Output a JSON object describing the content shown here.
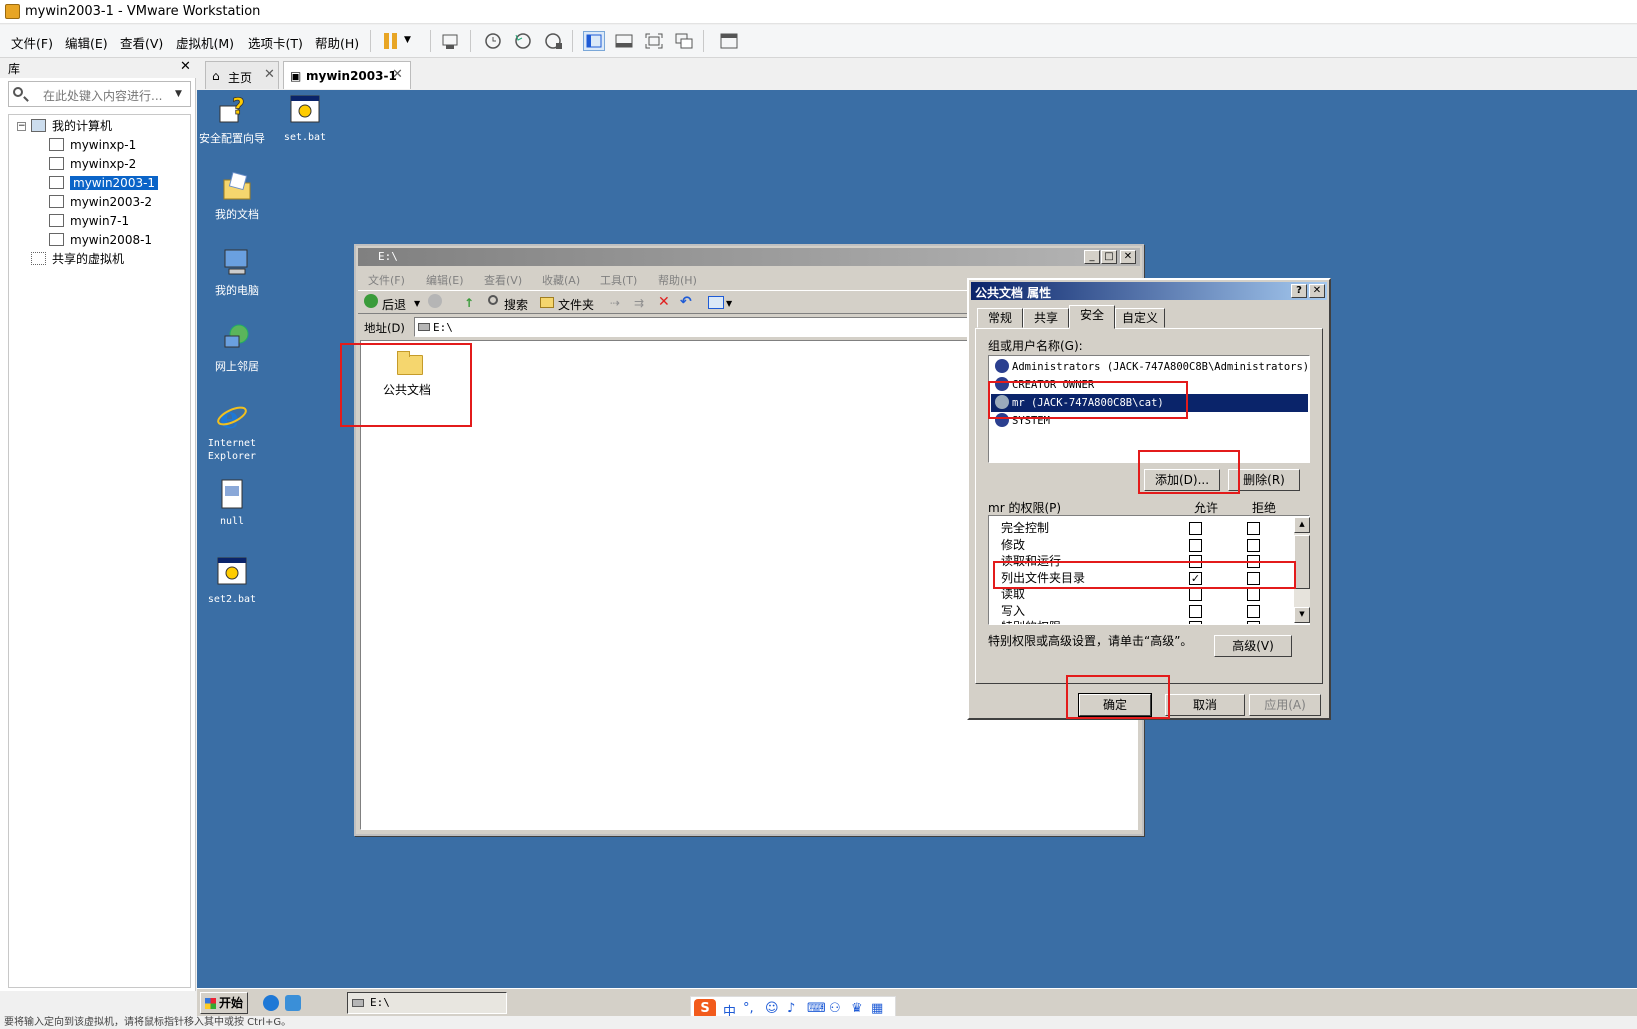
{
  "window": {
    "title": "mywin2003-1 - VMware Workstation"
  },
  "menubar": [
    "文件(F)",
    "编辑(E)",
    "查看(V)",
    "虚拟机(M)",
    "选项卡(T)",
    "帮助(H)"
  ],
  "library": {
    "title": "库",
    "search_placeholder": "在此处键入内容进行...",
    "root": "我的计算机",
    "vms": [
      "mywinxp-1",
      "mywinxp-2",
      "mywin2003-1",
      "mywin2003-2",
      "mywin7-1",
      "mywin2008-1"
    ],
    "selected_vm": "mywin2003-1",
    "shared": "共享的虚拟机"
  },
  "tabs": {
    "home": "主页",
    "vm": "mywin2003-1"
  },
  "desktop_icons": [
    "安全配置向导",
    "set.bat",
    "我的文档",
    "我的电脑",
    "网上邻居",
    "Internet Explorer",
    "null",
    "set2.bat"
  ],
  "explorer": {
    "title": "E:\\",
    "menu": [
      "文件(F)",
      "编辑(E)",
      "查看(V)",
      "收藏(A)",
      "工具(T)",
      "帮助(H)"
    ],
    "toolbar": {
      "back": "后退",
      "search": "搜索",
      "folders": "文件夹"
    },
    "address_label": "地址(D)",
    "address_value": "E:\\",
    "folder_name": "公共文档"
  },
  "properties": {
    "title": "公共文档 属性",
    "tabs": [
      "常规",
      "共享",
      "安全",
      "自定义"
    ],
    "active_tab": "安全",
    "users_label": "组或用户名称(G):",
    "users": [
      "Administrators (JACK-747A800C8B\\Administrators)",
      "CREATOR OWNER",
      "mr (JACK-747A800C8B\\cat)",
      "SYSTEM"
    ],
    "selected_user": "mr (JACK-747A800C8B\\cat)",
    "add_button": "添加(D)...",
    "remove_button": "删除(R)",
    "perm_label": "mr 的权限(P)",
    "allow_header": "允许",
    "deny_header": "拒绝",
    "permissions": [
      {
        "name": "完全控制",
        "allow": false,
        "deny": false
      },
      {
        "name": "修改",
        "allow": false,
        "deny": false
      },
      {
        "name": "读取和运行",
        "allow": false,
        "deny": false
      },
      {
        "name": "列出文件夹目录",
        "allow": true,
        "deny": false
      },
      {
        "name": "读取",
        "allow": false,
        "deny": false
      },
      {
        "name": "写入",
        "allow": false,
        "deny": false
      },
      {
        "name": "特别的权限",
        "allow": false,
        "deny": false
      }
    ],
    "advanced_note": "特别权限或高级设置，请单击“高级”。",
    "advanced_button": "高级(V)",
    "ok_button": "确定",
    "cancel_button": "取消",
    "apply_button": "应用(A)"
  },
  "taskbar": {
    "start": "开始",
    "task": "E:\\"
  },
  "ime": {
    "mode": "中"
  },
  "statusbar": "要将输入定向到该虚拟机，请将鼠标指针移入其中或按 Ctrl+G。",
  "colors": {
    "desktop": "#3a6ea5",
    "selection": "#0a246a",
    "highlight": "#e31b1b"
  }
}
